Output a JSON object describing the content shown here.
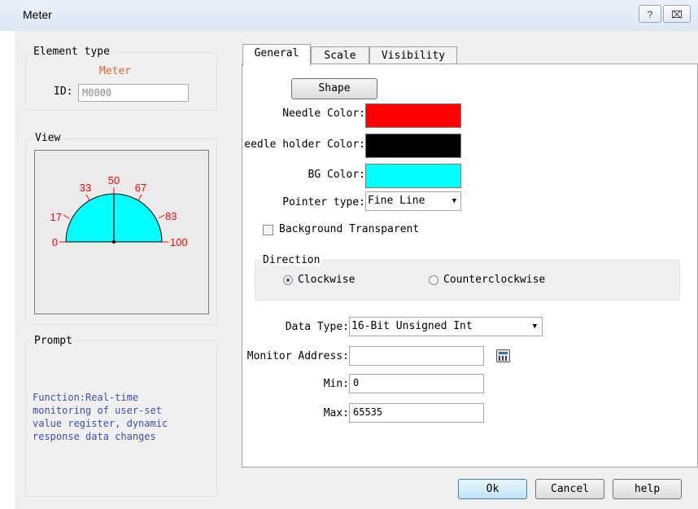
{
  "window": {
    "title": "Meter",
    "help_glyph": "?",
    "close_glyph": "⌧"
  },
  "element_type": {
    "legend": "Element type",
    "type_value": "Meter",
    "id_label": "ID:",
    "id_value": "M0000"
  },
  "view": {
    "legend": "View",
    "scale_labels": [
      "0",
      "17",
      "33",
      "50",
      "67",
      "83",
      "100"
    ],
    "colors": {
      "needle": "#ff0000",
      "holder": "#000000",
      "bg": "#00ffff",
      "scale": "#ff0000"
    }
  },
  "prompt": {
    "legend": "Prompt",
    "lines": [
      "Function:Real-time",
      "monitoring of user-set",
      "value register, dynamic",
      "response data changes"
    ]
  },
  "tabs": [
    "General",
    "Scale",
    "Visibility"
  ],
  "general": {
    "shape_button": "Shape",
    "needle_color_label": "Needle Color:",
    "holder_color_label": "eedle holder Color:",
    "bg_color_label": "BG Color:",
    "pointer_type_label": "Pointer type:",
    "pointer_type_value": "Fine Line",
    "bg_transparent_label": "Background Transparent",
    "direction": {
      "legend": "Direction",
      "clockwise": "Clockwise",
      "counterclockwise": "Counterclockwise",
      "selected": "Clockwise"
    },
    "data_type_label": "Data Type:",
    "data_type_value": "16-Bit Unsigned Int",
    "monitor_address_label": "Monitor Address:",
    "monitor_address_value": "",
    "calculator_icon": "calculator-icon",
    "min_label": "Min:",
    "min_value": "0",
    "max_label": "Max:",
    "max_value": "65535"
  },
  "buttons": {
    "ok": "Ok",
    "cancel": "Cancel",
    "help": "help"
  }
}
